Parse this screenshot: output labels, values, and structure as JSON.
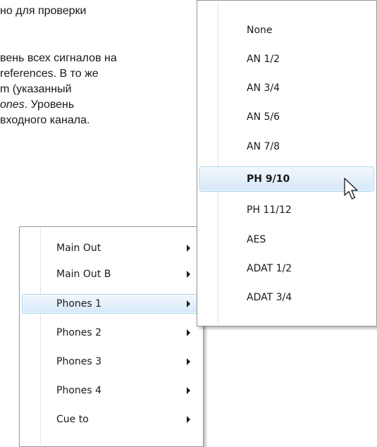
{
  "document": {
    "lines": [
      {
        "text": "но для проверки"
      },
      {
        "text": "вень всех сигналов на"
      },
      {
        "text": "references. В то же"
      },
      {
        "text": "m (указанный"
      },
      {
        "text_italic": "ones",
        "text_after": ". Уровень"
      },
      {
        "text": "входного канала."
      }
    ]
  },
  "output_menu": {
    "items": [
      {
        "label": "Main Out",
        "has_submenu": true,
        "highlighted": false
      },
      {
        "label": "Main Out B",
        "has_submenu": true,
        "highlighted": false
      },
      {
        "label": "Phones 1",
        "has_submenu": true,
        "highlighted": true
      },
      {
        "label": "Phones 2",
        "has_submenu": true,
        "highlighted": false
      },
      {
        "label": "Phones 3",
        "has_submenu": true,
        "highlighted": false
      },
      {
        "label": "Phones 4",
        "has_submenu": true,
        "highlighted": false
      },
      {
        "label": "Cue to",
        "has_submenu": true,
        "highlighted": false
      }
    ],
    "arrow_icon": "submenu-arrow-icon"
  },
  "source_menu": {
    "items": [
      {
        "label": "None",
        "highlighted": false,
        "bold": false
      },
      {
        "label": "AN 1/2",
        "highlighted": false,
        "bold": false
      },
      {
        "label": "AN 3/4",
        "highlighted": false,
        "bold": false
      },
      {
        "label": "AN 5/6",
        "highlighted": false,
        "bold": false
      },
      {
        "label": "AN 7/8",
        "highlighted": false,
        "bold": false
      },
      {
        "label": "PH 9/10",
        "highlighted": true,
        "bold": true
      },
      {
        "label": "PH 11/12",
        "highlighted": false,
        "bold": false
      },
      {
        "label": "AES",
        "highlighted": false,
        "bold": false
      },
      {
        "label": "ADAT 1/2",
        "highlighted": false,
        "bold": false
      },
      {
        "label": "ADAT 3/4",
        "highlighted": false,
        "bold": false
      }
    ]
  },
  "cursor": {
    "icon": "mouse-pointer-icon"
  },
  "colors": {
    "highlight_border": "#a8d8eb",
    "highlight_fill": "#e4f0fb",
    "menu_border": "#979797",
    "text": "#1a1a1a"
  }
}
